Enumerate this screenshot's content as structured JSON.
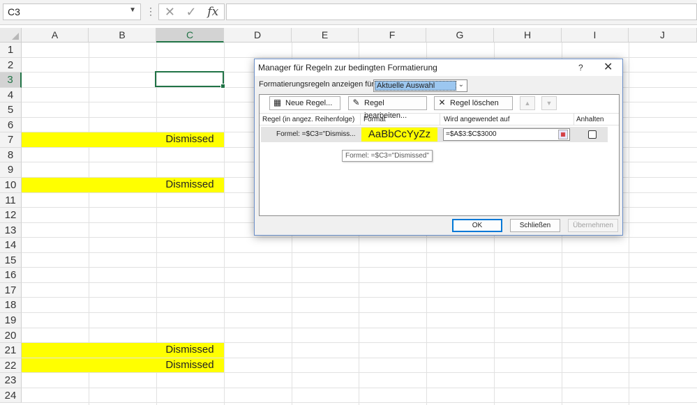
{
  "formula_bar": {
    "name_box": "C3",
    "dropdown_icon": "chevron-down-icon",
    "separator": "⋮",
    "cancel_glyph": "✕",
    "enter_glyph": "✓",
    "fx_label": "fx",
    "formula_value": ""
  },
  "columns": [
    "A",
    "B",
    "C",
    "D",
    "E",
    "F",
    "G",
    "H",
    "I",
    "J"
  ],
  "selected_column": "C",
  "rows": [
    "1",
    "2",
    "3",
    "4",
    "5",
    "6",
    "7",
    "8",
    "9",
    "10",
    "11",
    "12",
    "13",
    "14",
    "15",
    "16",
    "17",
    "18",
    "19",
    "20",
    "21",
    "22",
    "23",
    "24"
  ],
  "selected_row": "3",
  "active_cell": "C3",
  "highlight_color": "#FFFF00",
  "accent_color": "#217346",
  "cells": {
    "c7": "Dismissed",
    "c10": "Dismissed",
    "c21": "Dismissed",
    "c22": "Dismissed"
  },
  "dialog": {
    "title": "Manager für Regeln zur bedingten Formatierung",
    "help": "?",
    "close": "✕",
    "show_rules_label": "Formatierungsregeln anzeigen für:",
    "show_rules_value": "Aktuelle Auswahl",
    "toolbar": {
      "new_rule": "Neue Regel...",
      "edit_rule": "Regel bearbeiten...",
      "delete_rule": "Regel löschen",
      "move_up": "▲",
      "move_down": "▼"
    },
    "headers": {
      "rule": "Regel (in angez. Reihenfolge)",
      "format": "Format",
      "applies_to": "Wird angewendet auf",
      "stop": "Anhalten"
    },
    "rule": {
      "formula": "Formel: =$C3=\"Dismiss...",
      "format_preview": "AaBbCcYyZz",
      "applies_to": "=$A$3:$C$3000",
      "stop_if_true": false
    },
    "tooltip": "Formel: =$C3=\"Dismissed\"",
    "buttons": {
      "ok": "OK",
      "close": "Schließen",
      "apply": "Übernehmen"
    }
  }
}
